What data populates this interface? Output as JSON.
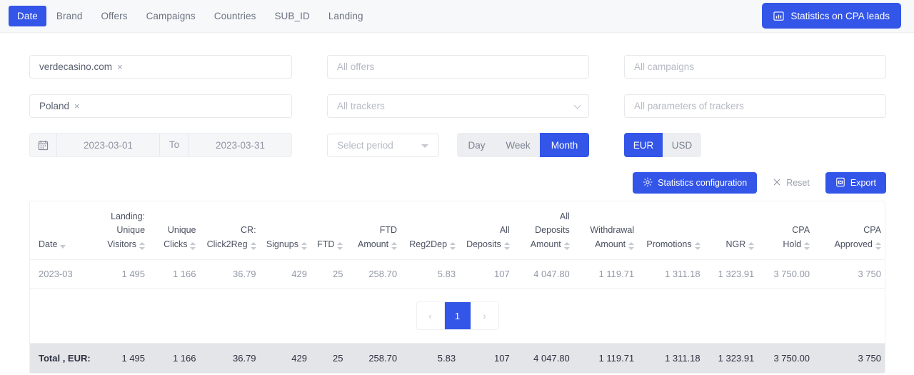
{
  "topbar": {
    "tabs": [
      {
        "label": "Date",
        "active": true
      },
      {
        "label": "Brand",
        "active": false
      },
      {
        "label": "Offers",
        "active": false
      },
      {
        "label": "Campaigns",
        "active": false
      },
      {
        "label": "Countries",
        "active": false
      },
      {
        "label": "SUB_ID",
        "active": false
      },
      {
        "label": "Landing",
        "active": false
      }
    ],
    "cpa_button": {
      "label": "Statistics on CPA leads",
      "icon": "chart-bar-icon"
    },
    "accent_color": "#3355e8"
  },
  "filters": {
    "brand": {
      "value": "verdecasino.com",
      "remove": "×"
    },
    "country": {
      "value": "Poland",
      "remove": "×"
    },
    "offers": {
      "placeholder": "All offers"
    },
    "trackers": {
      "placeholder": "All trackers",
      "icon": "chevron-down-icon"
    },
    "campaigns": {
      "placeholder": "All campaigns"
    },
    "tracker_params": {
      "placeholder": "All parameters of trackers"
    },
    "date_range": {
      "icon": "calendar-icon",
      "from": "2023-03-01",
      "to_label": "To",
      "to": "2023-03-31"
    },
    "period": {
      "placeholder": "Select period",
      "icon": "caret-down-icon"
    },
    "grouping": [
      {
        "label": "Day",
        "active": false
      },
      {
        "label": "Week",
        "active": false
      },
      {
        "label": "Month",
        "active": true
      }
    ],
    "currency": [
      {
        "label": "EUR",
        "active": true
      },
      {
        "label": "USD",
        "active": false
      }
    ]
  },
  "actions": {
    "config": {
      "label": "Statistics configuration",
      "icon": "gear-icon"
    },
    "reset": {
      "label": "Reset",
      "icon": "close-icon"
    },
    "export": {
      "label": "Export",
      "icon": "file-export-icon"
    }
  },
  "table": {
    "columns": [
      {
        "top": "",
        "mid": "",
        "label": "Date",
        "sort": "single"
      },
      {
        "top": "Landing:",
        "mid": "Unique",
        "label": "Visitors",
        "sort": "double"
      },
      {
        "top": "",
        "mid": "Unique",
        "label": "Clicks",
        "sort": "double"
      },
      {
        "top": "",
        "mid": "CR:",
        "label": "Click2Reg",
        "sort": "double"
      },
      {
        "top": "",
        "mid": "",
        "label": "Signups",
        "sort": "double"
      },
      {
        "top": "",
        "mid": "",
        "label": "FTD",
        "sort": "double"
      },
      {
        "top": "",
        "mid": "FTD",
        "label": "Amount",
        "sort": "double"
      },
      {
        "top": "",
        "mid": "",
        "label": "Reg2Dep",
        "sort": "double"
      },
      {
        "top": "",
        "mid": "All",
        "label": "Deposits",
        "sort": "double"
      },
      {
        "top": "All",
        "mid": "Deposits",
        "label": "Amount",
        "sort": "double"
      },
      {
        "top": "",
        "mid": "Withdrawal",
        "label": "Amount",
        "sort": "double"
      },
      {
        "top": "",
        "mid": "",
        "label": "Promotions",
        "sort": "double"
      },
      {
        "top": "",
        "mid": "",
        "label": "NGR",
        "sort": "double"
      },
      {
        "top": "",
        "mid": "CPA",
        "label": "Hold",
        "sort": "double"
      },
      {
        "top": "",
        "mid": "CPA",
        "label": "Approved",
        "sort": "double"
      }
    ],
    "rows": [
      [
        "2023-03",
        "1 495",
        "1 166",
        "36.79",
        "429",
        "25",
        "258.70",
        "5.83",
        "107",
        "4 047.80",
        "1 119.71",
        "1 311.18",
        "1 323.91",
        "3 750.00",
        "3 750"
      ]
    ],
    "pagination": {
      "prev": "‹",
      "pages": [
        "1"
      ],
      "next": "›",
      "current": "1"
    },
    "footer": [
      "Total , EUR:",
      "1 495",
      "1 166",
      "36.79",
      "429",
      "25",
      "258.70",
      "5.83",
      "107",
      "4 047.80",
      "1 119.71",
      "1 311.18",
      "1 323.91",
      "3 750.00",
      "3 750"
    ]
  }
}
